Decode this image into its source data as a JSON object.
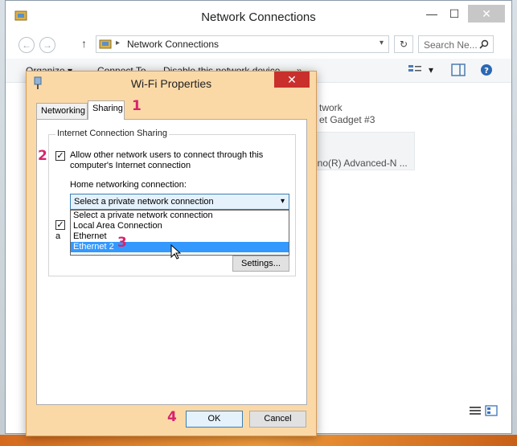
{
  "explorer": {
    "title": "Network Connections",
    "address": "Network Connections",
    "search_placeholder": "Search Ne...",
    "commands": {
      "organize": "Organize ▾",
      "connect": "Connect To",
      "disable": "Disable this network device",
      "more": "»"
    },
    "background_adapter": {
      "line1": "twork",
      "line2": "et Gadget #3",
      "line3": "rino(R) Advanced-N ..."
    },
    "controls": {
      "minimize": "—",
      "maximize": "☐",
      "close": "✕",
      "up": "↑",
      "refresh": "↻"
    }
  },
  "dialog": {
    "title": "Wi-Fi Properties",
    "close": "✕",
    "tabs": [
      {
        "label": "Networking"
      },
      {
        "label": "Sharing"
      }
    ],
    "group_title": "Internet Connection Sharing",
    "allow_checkbox": {
      "checked": true,
      "label_line1": "Allow other network users to connect through this",
      "label_line2": "computer's Internet connection"
    },
    "home_label": "Home networking connection:",
    "combo_value": "Select a private network connection",
    "dropdown_options": [
      "Select a private network connection",
      "Local Area Connection",
      "Ethernet",
      "Ethernet 2"
    ],
    "selected_option_index": 3,
    "second_checkbox_checked": true,
    "second_checkbox_partial_label": "a",
    "settings_label": "Settings...",
    "ok_label": "OK",
    "cancel_label": "Cancel"
  },
  "annotations": {
    "step1": "1",
    "step2": "2",
    "step3": "3",
    "step4": "4",
    "color": "#d6246e"
  }
}
